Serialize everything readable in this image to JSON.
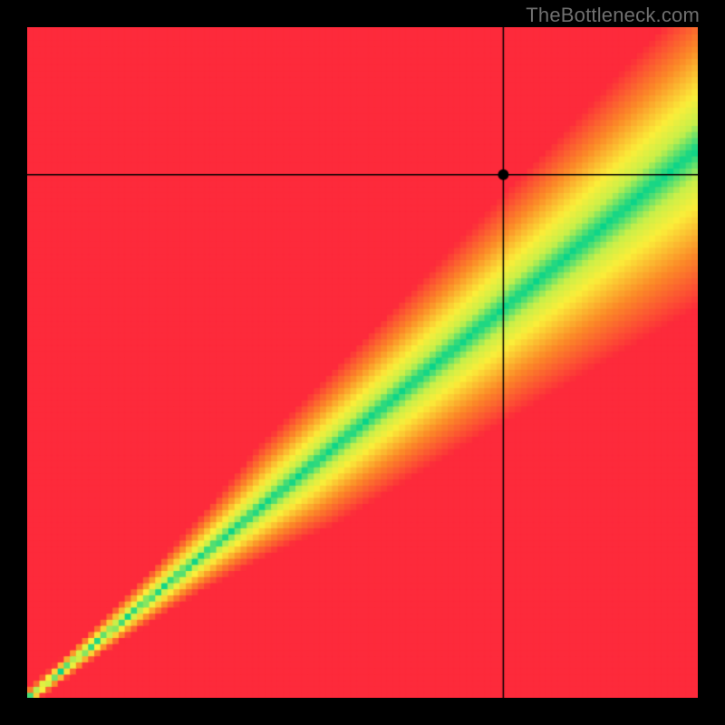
{
  "watermark": "TheBottleneck.com",
  "chart_data": {
    "type": "heatmap",
    "title": "",
    "xlabel": "",
    "ylabel": "",
    "xlim": [
      0,
      1
    ],
    "ylim": [
      0,
      1
    ],
    "crosshair": {
      "x": 0.71,
      "y": 0.78
    },
    "marker": {
      "x": 0.71,
      "y": 0.78
    },
    "band": {
      "description": "green optimal band along diagonal y ≈ slope·x, surrounded by yellow, fading to red away from it",
      "slope": 0.82,
      "half_width_green": 0.045,
      "half_width_yellow": 0.1,
      "widen_with_x": 0.55
    },
    "colors": {
      "red": "#fd2a3b",
      "orange": "#fb8a28",
      "yellow": "#fcee3a",
      "yellowgreen": "#c8f04a",
      "green": "#07d48b"
    },
    "pixelation": 110
  }
}
